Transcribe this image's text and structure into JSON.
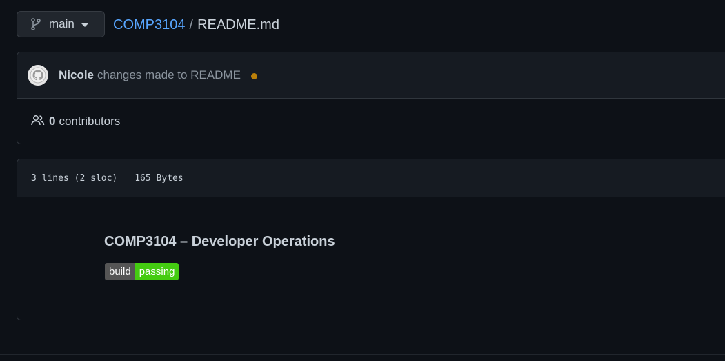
{
  "branch": {
    "name": "main",
    "icon": "git-branch-icon"
  },
  "breadcrumb": {
    "repo": "COMP3104",
    "separator": "/",
    "file": "README.md"
  },
  "commit": {
    "author": "Nicole",
    "message": "changes made to README",
    "avatar_icon": "github-avatar",
    "status_color": "#bb8009"
  },
  "contributors": {
    "icon": "people-icon",
    "count": "0",
    "label": "contributors"
  },
  "file": {
    "lines": "3 lines (2 sloc)",
    "size": "165 Bytes"
  },
  "readme": {
    "title": "COMP3104 – Developer Operations",
    "badge": {
      "label": "build",
      "status": "passing",
      "label_color": "#555555",
      "status_color": "#44cc11"
    }
  },
  "colors": {
    "background": "#0d1117",
    "link": "#58a6ff",
    "border": "#30363d"
  }
}
